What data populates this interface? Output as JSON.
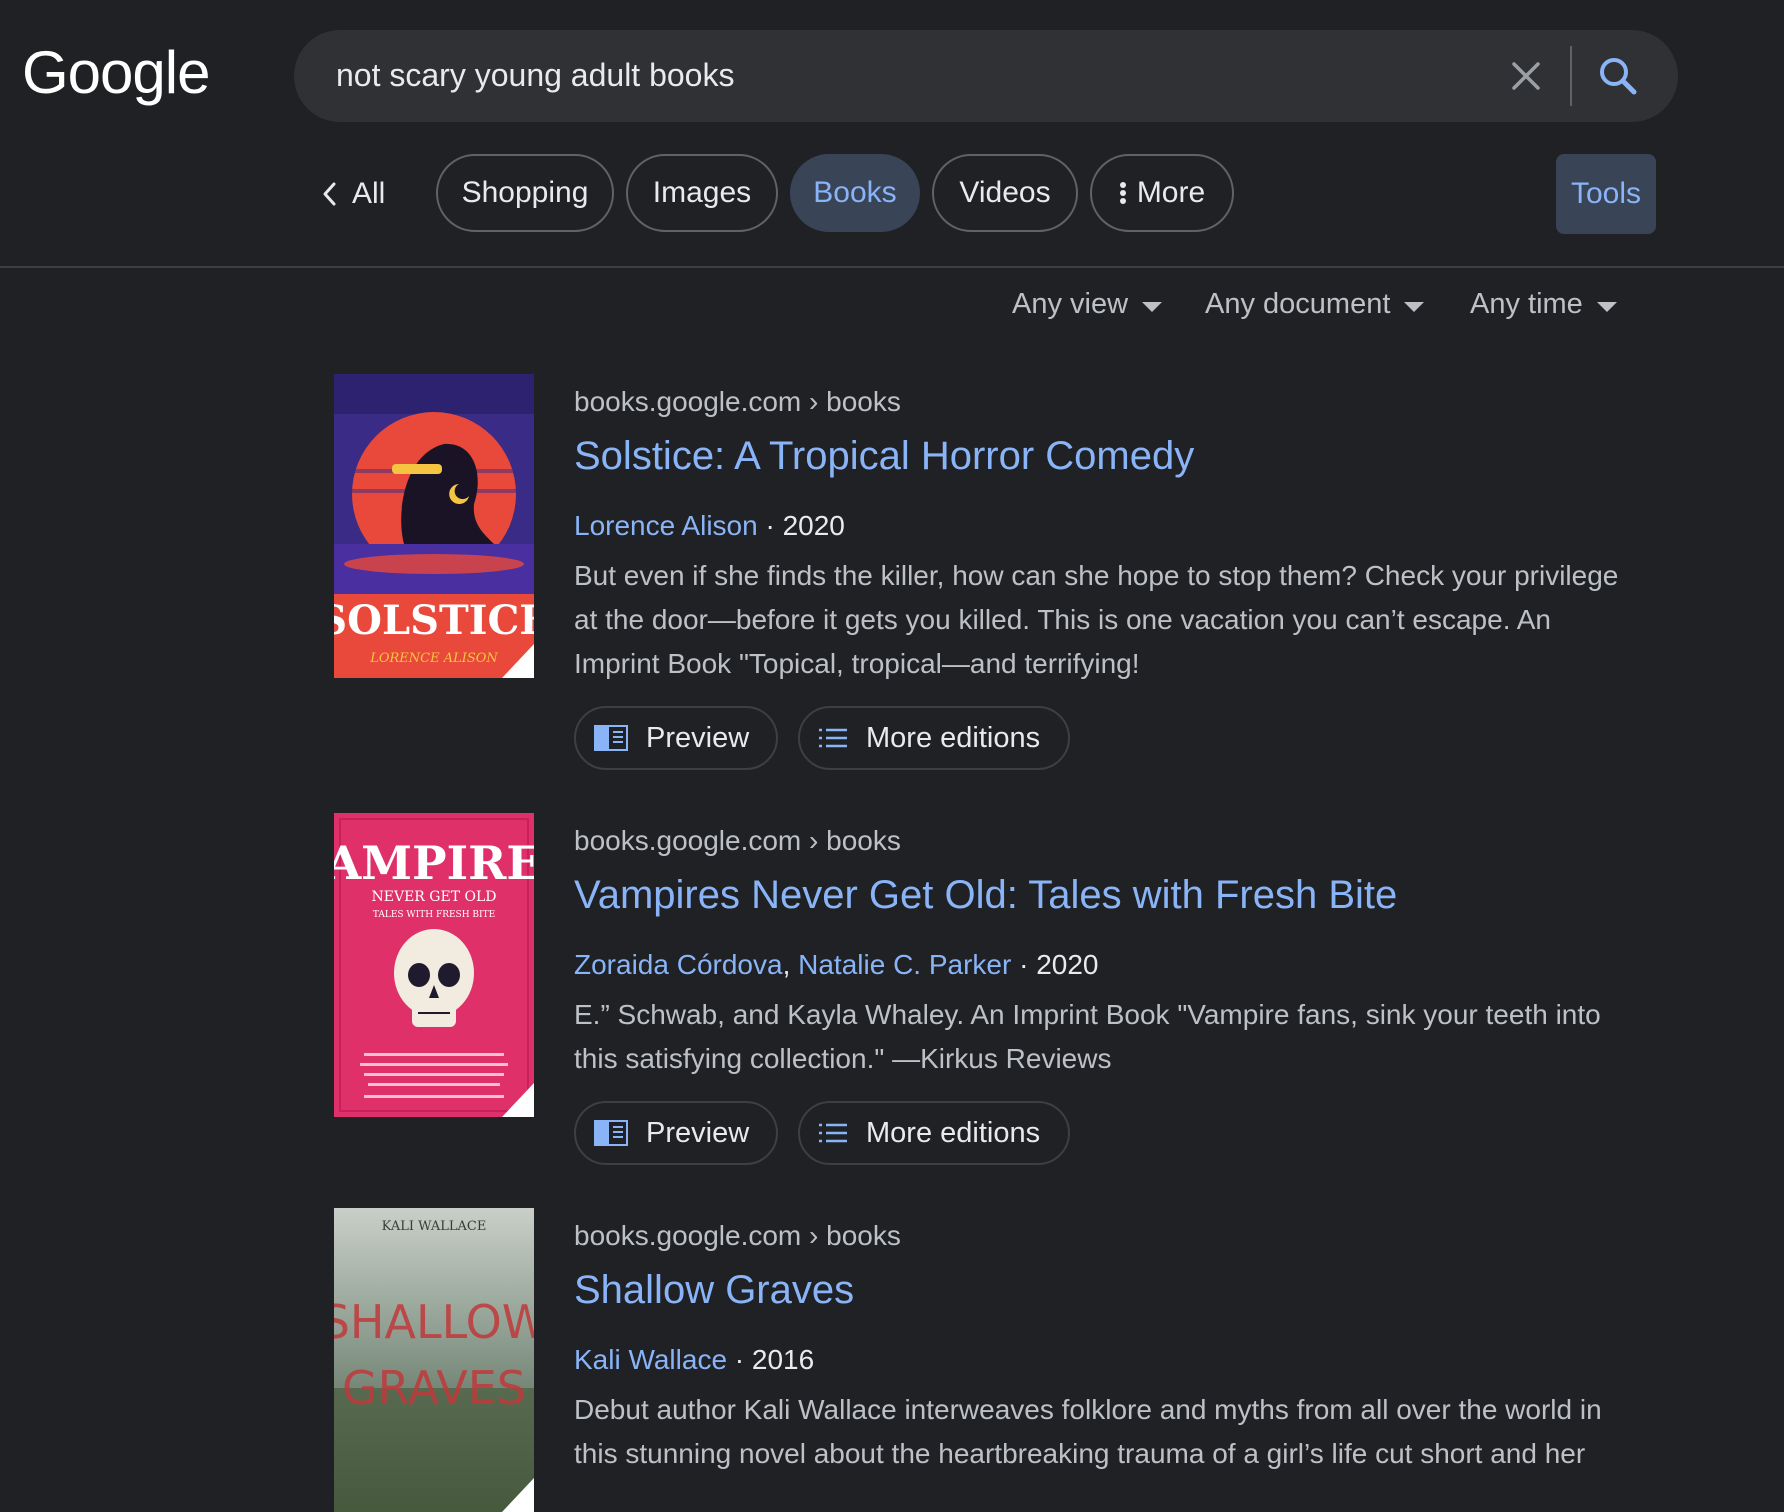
{
  "logo_text": "Google",
  "search": {
    "query": "not scary young adult books"
  },
  "tabs": {
    "back_label": "All",
    "items": [
      {
        "label": "Shopping",
        "active": false
      },
      {
        "label": "Images",
        "active": false
      },
      {
        "label": "Books",
        "active": true
      },
      {
        "label": "Videos",
        "active": false
      },
      {
        "label": "More",
        "active": false
      }
    ],
    "tools_label": "Tools"
  },
  "filters": [
    "Any view",
    "Any document",
    "Any time"
  ],
  "results": [
    {
      "source": "books.google.com",
      "path": "books",
      "title": "Solstice: A Tropical Horror Comedy",
      "authors": [
        "Lorence Alison"
      ],
      "year": "2020",
      "snippet": "But even if she finds the killer, how can she hope to stop them? Check your privilege at the door—before it gets you killed. This is one vacation you can’t escape. An Imprint Book \"Topical, tropical—and terrifying!",
      "preview_label": "Preview",
      "editions_label": "More editions",
      "cover": {
        "title_text": "SOLSTICE",
        "author_text": "LORENCE ALISON"
      }
    },
    {
      "source": "books.google.com",
      "path": "books",
      "title": "Vampires Never Get Old: Tales with Fresh Bite",
      "authors": [
        "Zoraida Córdova",
        "Natalie C. Parker"
      ],
      "year": "2020",
      "snippet": "E.” Schwab, and Kayla Whaley. An Imprint Book \"Vampire fans, sink your teeth into this satisfying collection.\" —Kirkus Reviews",
      "preview_label": "Preview",
      "editions_label": "More editions",
      "cover": {
        "title_text": "VAMPIRES",
        "subtitle_text": "NEVER GET OLD",
        "tagline_text": "TALES WITH FRESH BITE"
      }
    },
    {
      "source": "books.google.com",
      "path": "books",
      "title": "Shallow Graves",
      "authors": [
        "Kali Wallace"
      ],
      "year": "2016",
      "snippet": "Debut author Kali Wallace interweaves folklore and myths from all over the world in this stunning novel about the heartbreaking trauma of a girl’s life cut short and her",
      "cover": {
        "author_text": "KALI WALLACE",
        "title_line1": "SHALLOW",
        "title_line2": "GRAVES"
      }
    }
  ],
  "colors": {
    "background": "#202124",
    "link": "#8ab4f8",
    "active_chip": "#394457"
  }
}
